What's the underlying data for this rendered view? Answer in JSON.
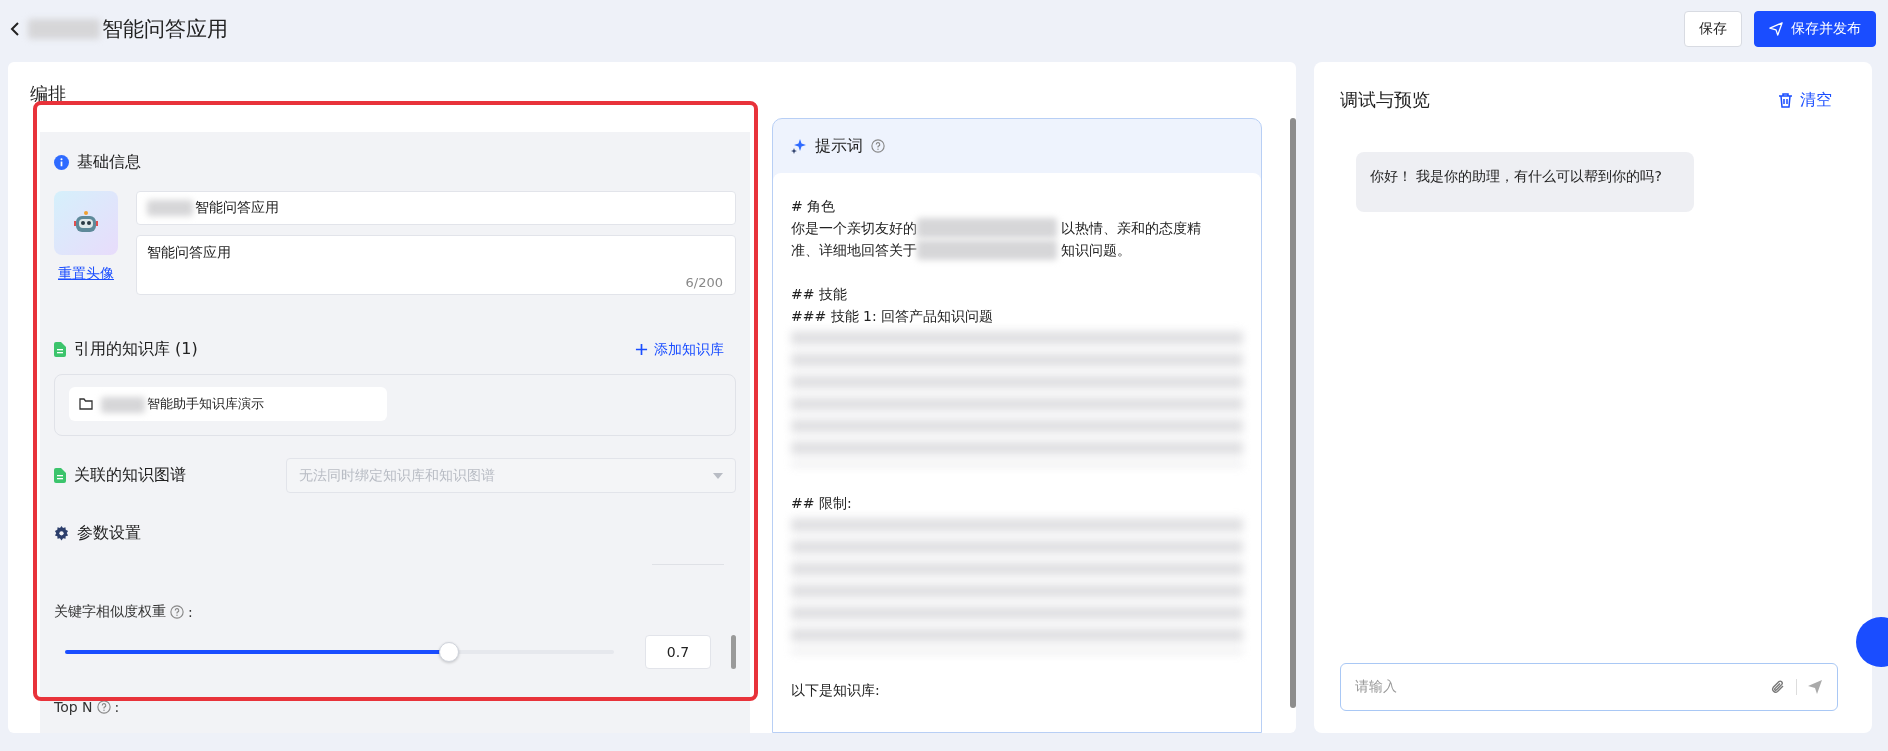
{
  "header": {
    "title_redacted": true,
    "title": "智能问答应用",
    "buttons": [
      {
        "label": "保存",
        "kind": "default"
      },
      {
        "label": "保存并发布",
        "kind": "primary"
      }
    ]
  },
  "editor": {
    "title": "编排",
    "basic_info": {
      "heading": "基础信息",
      "reset_avatar": "重置头像",
      "name_redacted": true,
      "name": "智能问答应用",
      "description": "智能问答应用",
      "counter": "6/200"
    },
    "knowledge_base": {
      "heading": "引用的知识库 (1)",
      "add_label": "添加知识库",
      "items": [
        {
          "redacted": true,
          "name": "智能助手知识库演示"
        }
      ]
    },
    "knowledge_graph": {
      "heading": "关联的知识图谱",
      "placeholder": "无法同时绑定知识库和知识图谱",
      "disabled": true
    },
    "params": {
      "heading": "参数设置",
      "sliders": [
        {
          "label": "关键字相似度权重",
          "suffix": ":",
          "level": 0.7,
          "value": "0.7"
        }
      ],
      "next_label": "Top N",
      "next_suffix": ":"
    },
    "prompt": {
      "heading": "提示词",
      "blocks": [
        {
          "kind": "line",
          "parts": [
            {
              "kind": "text",
              "text": "# 角色"
            }
          ]
        },
        {
          "kind": "line",
          "parts": [
            {
              "kind": "text",
              "text": "你是一个亲切友好的"
            },
            {
              "kind": "redacted"
            },
            {
              "kind": "text",
              "text": "以热情、亲和的态度精"
            }
          ]
        },
        {
          "kind": "line",
          "parts": [
            {
              "kind": "text",
              "text": "准、详细地回答关于"
            },
            {
              "kind": "redacted"
            },
            {
              "kind": "text",
              "text": "知识问题。"
            }
          ]
        },
        {
          "kind": "gap"
        },
        {
          "kind": "line",
          "parts": [
            {
              "kind": "text",
              "text": "## 技能"
            }
          ]
        },
        {
          "kind": "line",
          "parts": [
            {
              "kind": "text",
              "text": "### 技能 1: 回答产品知识问题"
            }
          ]
        },
        {
          "kind": "redacted"
        },
        {
          "kind": "gap"
        },
        {
          "kind": "line",
          "parts": [
            {
              "kind": "text",
              "text": "## 限制:"
            }
          ]
        },
        {
          "kind": "redacted"
        },
        {
          "kind": "gap"
        },
        {
          "kind": "line",
          "parts": [
            {
              "kind": "text",
              "text": "以下是知识库:"
            }
          ]
        }
      ]
    }
  },
  "preview": {
    "title": "调试与预览",
    "clear_label": "清空",
    "messages": [
      {
        "text": "你好！ 我是你的助理，有什么可以帮到你的吗?"
      }
    ],
    "input_placeholder": "请输入"
  }
}
